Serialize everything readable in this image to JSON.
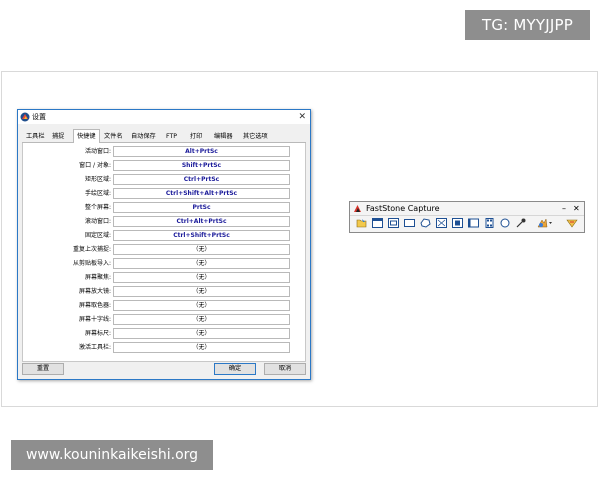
{
  "watermark": {
    "tg": "TG: MYYJJPP",
    "url": "www.kouninkaikeishi.org"
  },
  "dialog": {
    "title": "设置",
    "tabs": [
      "工具栏",
      "捕捉",
      "快捷键",
      "文件名",
      "自动保存",
      "FTP",
      "打印",
      "编辑器",
      "其它选项"
    ],
    "active_tab": "快捷键",
    "rows": [
      {
        "label": "活动窗口:",
        "value": "Alt+PrtSc"
      },
      {
        "label": "窗口 / 对象:",
        "value": "Shift+PrtSc"
      },
      {
        "label": "矩形区域:",
        "value": "Ctrl+PrtSc"
      },
      {
        "label": "手绘区域:",
        "value": "Ctrl+Shift+Alt+PrtSc"
      },
      {
        "label": "整个屏幕:",
        "value": "PrtSc"
      },
      {
        "label": "滚动窗口:",
        "value": "Ctrl+Alt+PrtSc"
      },
      {
        "label": "固定区域:",
        "value": "Ctrl+Shift+PrtSc"
      },
      {
        "label": "重复上次捕捉:",
        "value": "（无）"
      },
      {
        "label": "从剪贴板导入:",
        "value": "（无）"
      },
      {
        "label": "屏幕聚焦:",
        "value": "（无）"
      },
      {
        "label": "屏幕放大镜:",
        "value": "（无）"
      },
      {
        "label": "屏幕取色器:",
        "value": "（无）"
      },
      {
        "label": "屏幕十字线:",
        "value": "（无）"
      },
      {
        "label": "屏幕标尺:",
        "value": "（无）"
      },
      {
        "label": "激活工具栏:",
        "value": "（无）"
      }
    ],
    "buttons": {
      "reset": "重置",
      "ok": "确定",
      "cancel": "取消"
    }
  },
  "faststone": {
    "title": "FastStone Capture",
    "minimize": "–",
    "close": "✕",
    "tools": [
      "open-file-icon",
      "capture-window-icon",
      "capture-object-icon",
      "capture-rectangle-icon",
      "capture-freehand-icon",
      "capture-fullscreen-icon",
      "capture-scrolling-icon",
      "capture-fixed-region-icon",
      "video-recorder-icon",
      "magnifier-icon",
      "color-picker-icon",
      "output-destination-icon",
      "settings-menu-icon"
    ]
  }
}
